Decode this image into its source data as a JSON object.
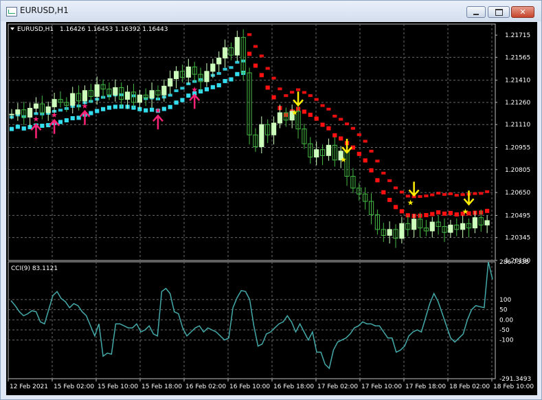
{
  "window": {
    "title": "EURUSD,H1",
    "buttons": [
      "minimize",
      "maximize",
      "close"
    ]
  },
  "chart_data": [
    {
      "type": "candlestick",
      "symbol_label": "EURUSD,H1",
      "ohlc_label": "1.16426 1.16453 1.16392 1.16443",
      "y_ticks": [
        "1.21715",
        "1.21565",
        "1.21410",
        "1.21260",
        "1.21110",
        "1.20955",
        "1.20805",
        "1.20650",
        "1.20495",
        "1.20345",
        "1.20190"
      ],
      "ylim": [
        1.2019,
        1.2179
      ],
      "grid": true,
      "close": [
        1.2118,
        1.2121,
        1.2116,
        1.2122,
        1.2125,
        1.2119,
        1.2123,
        1.2128,
        1.2126,
        1.2124,
        1.2132,
        1.2127,
        1.2134,
        1.213,
        1.2138,
        1.2135,
        1.2131,
        1.2136,
        1.2128,
        1.2133,
        1.2126,
        1.2131,
        1.2129,
        1.2134,
        1.2131,
        1.2137,
        1.2142,
        1.2147,
        1.2143,
        1.215,
        1.2145,
        1.214,
        1.2147,
        1.2152,
        1.2156,
        1.2163,
        1.2158,
        1.217,
        1.2146,
        1.2104,
        1.2096,
        1.2111,
        1.2104,
        1.2112,
        1.2119,
        1.2114,
        1.212,
        1.2108,
        1.2098,
        1.2089,
        1.2094,
        1.209,
        1.2097,
        1.2087,
        1.2093,
        1.2076,
        1.2068,
        1.2064,
        1.2059,
        1.205,
        1.204,
        1.2036,
        1.204,
        1.2034,
        1.2044,
        1.204,
        1.2047,
        1.2041,
        1.2039,
        1.2045,
        1.2042,
        1.2038,
        1.2043,
        1.204,
        1.2044,
        1.2041,
        1.2048,
        1.2043,
        1.2046
      ]
    },
    {
      "type": "line",
      "title": "CCI(9) 83.1121",
      "y_ticks": [
        "286.7338",
        "100",
        "50",
        "0.00",
        "-50",
        "-100",
        "-291.3493"
      ],
      "ylim": [
        -291.3493,
        286.7338
      ],
      "grid": true,
      "series": [
        {
          "values": [
            95,
            70,
            40,
            20,
            30,
            45,
            40,
            -10,
            -20,
            50,
            120,
            140,
            105,
            90,
            60,
            80,
            70,
            40,
            20,
            -30,
            -80,
            -20,
            -180,
            -165,
            -170,
            -20,
            -20,
            -30,
            -40,
            -40,
            -20,
            -60,
            -50,
            -30,
            -70,
            -80,
            140,
            155,
            130,
            40,
            30,
            -40,
            -80,
            -60,
            -40,
            -30,
            -60,
            -40,
            -50,
            -60,
            -80,
            -100,
            -90,
            60,
            110,
            145,
            140,
            100,
            -30,
            -130,
            -120,
            -70,
            -60,
            -40,
            -20,
            -10,
            20,
            -10,
            -60,
            -20,
            -60,
            -100,
            -60,
            -160,
            -160,
            -220,
            -240,
            -150,
            -110,
            -100,
            -90,
            -70,
            -40,
            -30,
            -10,
            -20,
            -20,
            -30,
            -30,
            -60,
            -90,
            -90,
            -160,
            -150,
            -130,
            -80,
            -60,
            -50,
            -60,
            10,
            80,
            130,
            90,
            30,
            -30,
            -90,
            -110,
            -90,
            -70,
            0,
            50,
            70,
            65,
            60,
            286.7,
            200
          ]
        }
      ]
    }
  ],
  "x_axis_labels": [
    "12 Feb 2021",
    "15 Feb 02:00",
    "15 Feb 10:00",
    "15 Feb 18:00",
    "16 Feb 02:00",
    "16 Feb 10:00",
    "16 Feb 18:00",
    "17 Feb 02:00",
    "17 Feb 10:00",
    "17 Feb 18:00",
    "18 Feb 02:00",
    "18 Feb 10:00"
  ],
  "colors": {
    "background": "#000000",
    "grid": "#6a6a6a",
    "bull_candle": "#ccffbb",
    "bear_candle": "#44bb44",
    "band_up": "#33ddee",
    "band_down": "#ff1111",
    "arrow_up": "#ff2277",
    "arrow_down": "#ffee00",
    "cci_line": "#44aaaa"
  },
  "icons": {
    "window_icon": "chart-window-icon",
    "collapse_icon": "triangle-down-icon"
  }
}
